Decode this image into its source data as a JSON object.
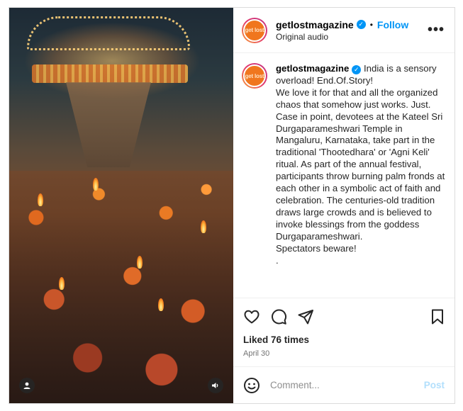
{
  "post": {
    "username": "getlostmagazine",
    "avatar_text": "get lost",
    "follow_label": "Follow",
    "separator": "•",
    "audio_label": "Original audio",
    "more_icon": "more-horizontal-icon",
    "caption": {
      "username": "getlostmagazine",
      "lines": [
        "India is a sensory overload! End.Of.Story!",
        "We love it for that and all the organized chaos that somehow just works. Just.",
        "Case in point, devotees at the Kateel Sri Durgaparameshwari Temple in Mangaluru, Karnataka, take part in the traditional 'Thootedhara' or 'Agni Keli' ritual. As part of the annual festival, participants throw burning palm fronds at each other in a symbolic act of faith and celebration. The centuries-old tradition draws large crowds and is believed to invoke blessings from the goddess Durgaparameshwari.",
        "Spectators beware!",
        "."
      ]
    },
    "likes_label": "Liked 76 times",
    "date_label": "April 30",
    "comment_placeholder": "Comment...",
    "post_label": "Post",
    "media_icons": {
      "tag": "user-tag-icon",
      "audio": "speaker-icon"
    }
  },
  "colors": {
    "accent": "#0095f6",
    "post_disabled": "#b2dffc",
    "avatar_orange": "#f0761e",
    "border": "#dbdbdb"
  }
}
